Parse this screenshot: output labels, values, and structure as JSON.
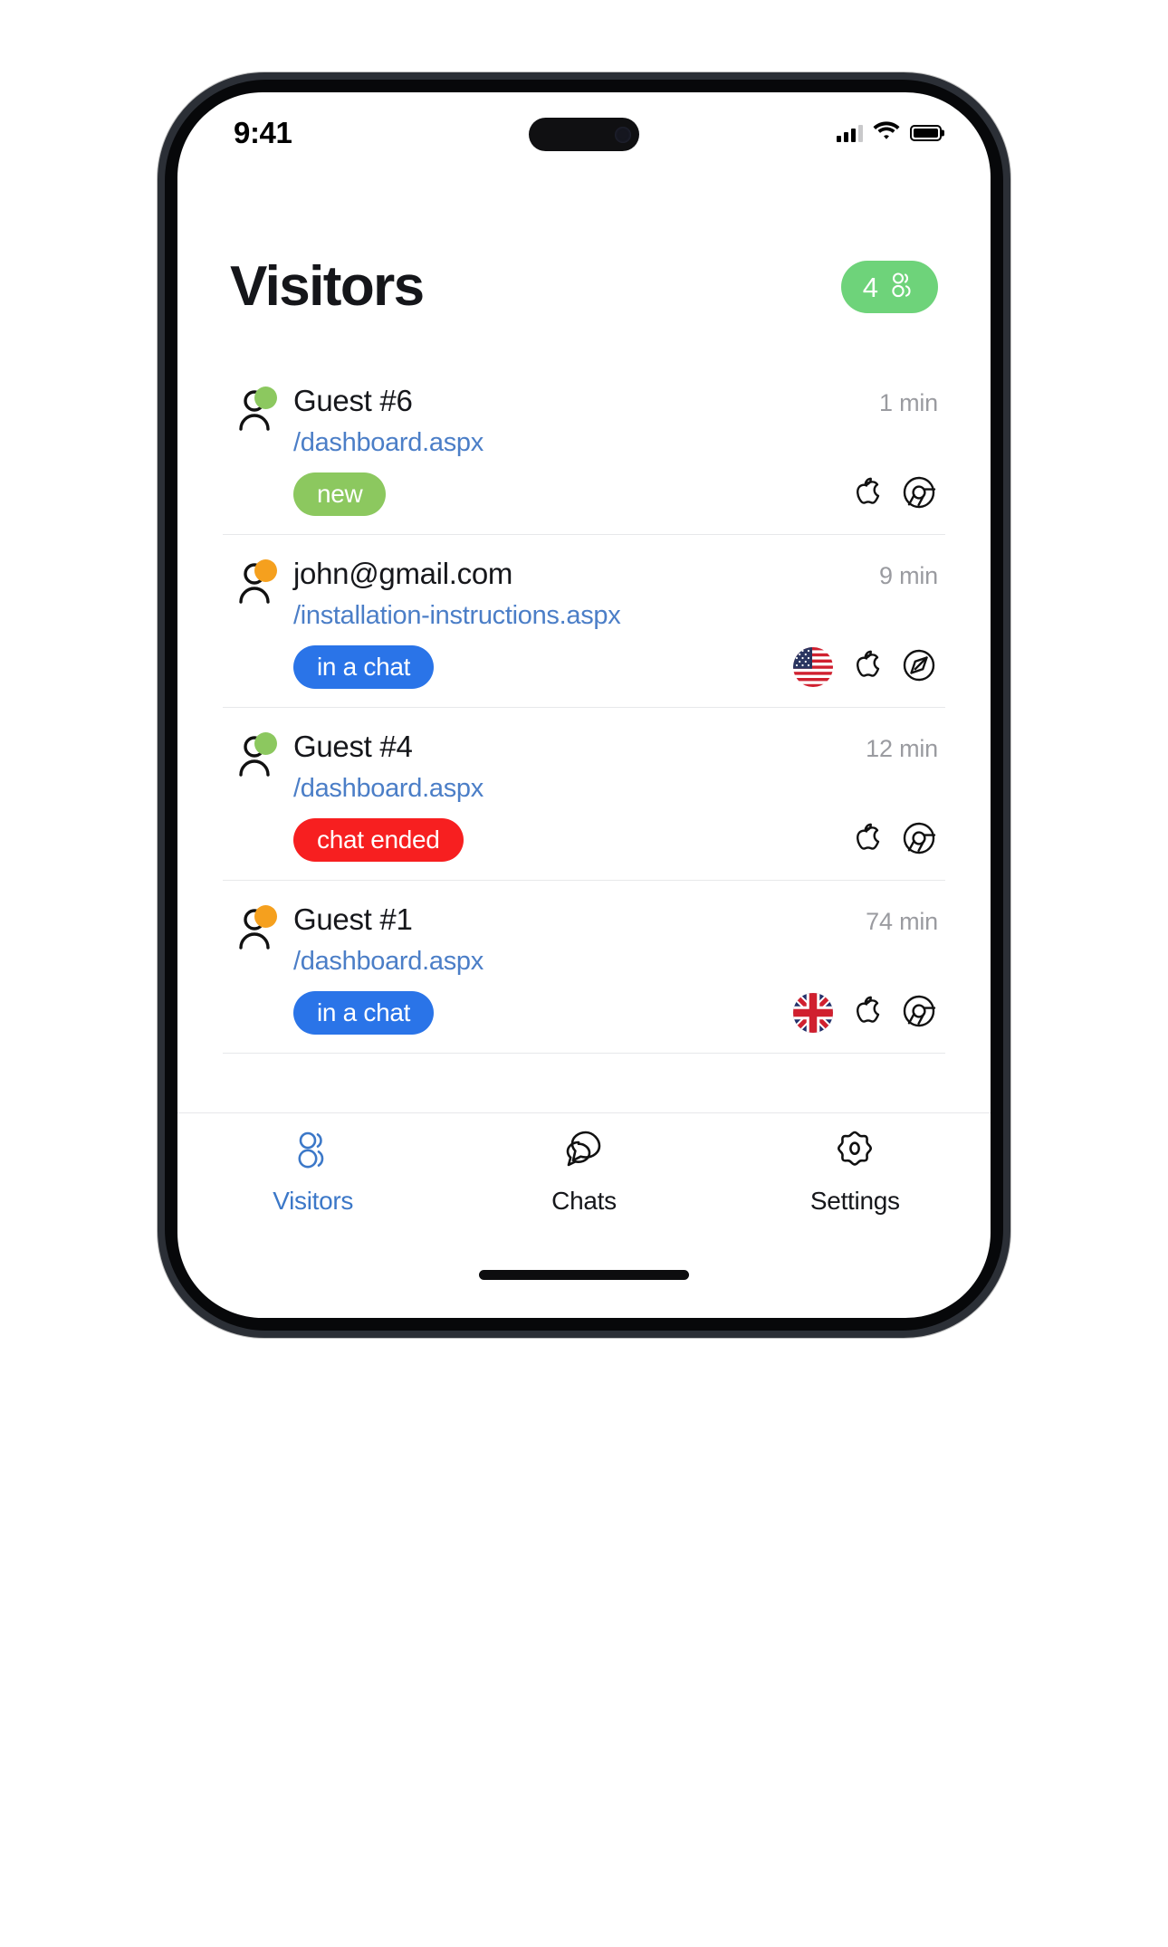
{
  "status_bar": {
    "time": "9:41",
    "signal_icon": "cellular-signal-icon",
    "wifi_icon": "wifi-icon",
    "battery_icon": "battery-full-icon"
  },
  "header": {
    "title": "Visitors",
    "count": "4",
    "count_icon": "people-icon",
    "badge_color": "#6ed37a"
  },
  "colors": {
    "link": "#4b7ec7",
    "green": "#6ed37a",
    "blue": "#2a74e8",
    "red": "#f71f20",
    "orange": "#f5a01e",
    "online_green": "#8cc85f",
    "tab_active": "#3c78c8",
    "muted": "#9a9ba0"
  },
  "visitors": [
    {
      "name": "Guest #6",
      "time": "1 min",
      "url": "/dashboard.aspx",
      "status_label": "new",
      "status_color": "#8cc85f",
      "dot_color": "#8cc85f",
      "dot_state": "online",
      "flag": null,
      "flag_name": null,
      "os_icon": "apple-icon",
      "browser_icon": "chrome-icon"
    },
    {
      "name": "john@gmail.com",
      "time": "9 min",
      "url": "/installation-instructions.aspx",
      "status_label": "in a chat",
      "status_color": "#2a74e8",
      "dot_color": "#f5a01e",
      "dot_state": "away",
      "flag": "US",
      "flag_name": "flag-us-icon",
      "os_icon": "apple-icon",
      "browser_icon": "safari-icon"
    },
    {
      "name": "Guest #4",
      "time": "12 min",
      "url": "/dashboard.aspx",
      "status_label": "chat ended",
      "status_color": "#f71f20",
      "dot_color": "#8cc85f",
      "dot_state": "online",
      "flag": null,
      "flag_name": null,
      "os_icon": "apple-icon",
      "browser_icon": "chrome-icon"
    },
    {
      "name": "Guest #1",
      "time": "74 min",
      "url": "/dashboard.aspx",
      "status_label": "in a chat",
      "status_color": "#2a74e8",
      "dot_color": "#f5a01e",
      "dot_state": "away",
      "flag": "GB",
      "flag_name": "flag-gb-icon",
      "os_icon": "apple-icon",
      "browser_icon": "chrome-icon"
    }
  ],
  "tabs": [
    {
      "label": "Visitors",
      "icon": "people-icon",
      "active": true
    },
    {
      "label": "Chats",
      "icon": "chat-bubbles-icon",
      "active": false
    },
    {
      "label": "Settings",
      "icon": "gear-icon",
      "active": false
    }
  ]
}
